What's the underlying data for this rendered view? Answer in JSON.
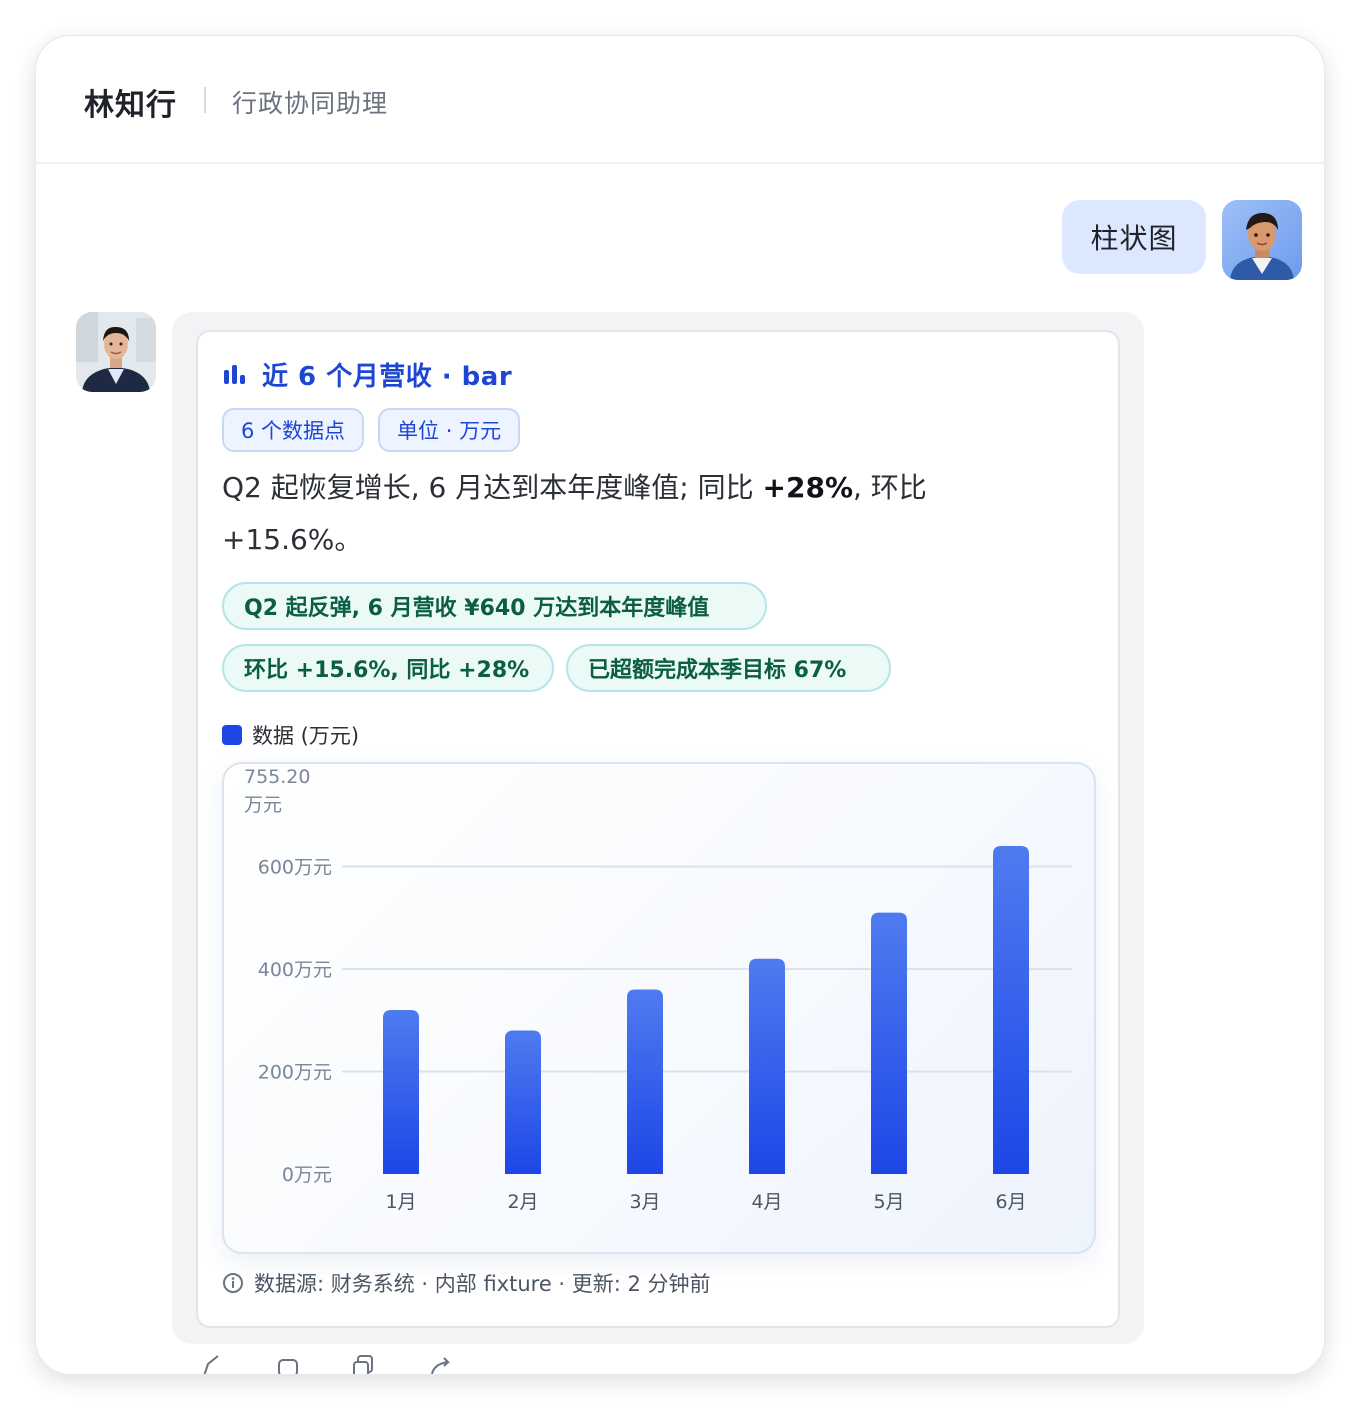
{
  "header": {
    "name": "林知行",
    "role": "行政协同助理"
  },
  "user_message": "柱状图",
  "card": {
    "title": "近 6 个月营收 · bar",
    "chips": [
      "6 个数据点",
      "单位 · 万元"
    ],
    "summary_pre": "Q2 起恢复增长, 6 月达到本年度峰值; 同比 ",
    "summary_bold": "+28%",
    "summary_post": ", 环比 +15.6%。",
    "insights": [
      "Q2 起反弹, 6 月营收 ¥640 万达到本年度峰值",
      "环比 +15.6%, 同比 +28%",
      "已超额完成本季目标 67%"
    ],
    "legend": "数据 (万元)",
    "source": "数据源: 财务系统 · 内部 fixture · 更新: 2 分钟前"
  },
  "chart_data": {
    "type": "bar",
    "categories": [
      "1月",
      "2月",
      "3月",
      "4月",
      "5月",
      "6月"
    ],
    "series": [
      {
        "name": "数据 (万元)",
        "values": [
          320,
          280,
          360,
          420,
          510,
          640
        ]
      }
    ],
    "ymax_label": "755.20",
    "ymax_unit": "万元",
    "y_ticks": [
      "0万元",
      "200万元",
      "400万元",
      "600万元"
    ],
    "ylim": [
      0,
      755.2
    ],
    "grid": true,
    "colors": {
      "bar_top": "#4f7bf0",
      "bar_bottom": "#1d46e6"
    }
  },
  "icons": {
    "title": "bar-chart-icon",
    "source": "info-icon",
    "actions": [
      "edit-icon",
      "copy-icon",
      "duplicate-icon",
      "share-icon"
    ]
  }
}
